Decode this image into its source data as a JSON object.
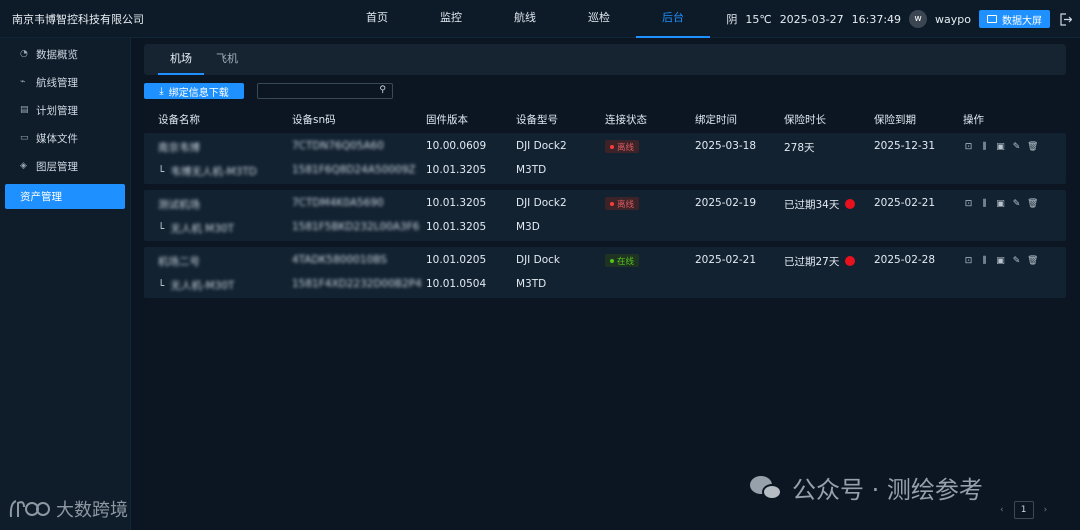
{
  "header": {
    "company": "南京韦博智控科技有限公司",
    "nav": [
      {
        "label": "首页",
        "active": false
      },
      {
        "label": "监控",
        "active": false
      },
      {
        "label": "航线",
        "active": false
      },
      {
        "label": "巡检",
        "active": false
      },
      {
        "label": "后台",
        "active": true
      }
    ],
    "weather": "阴",
    "temperature": "15℃",
    "date": "2025-03-27",
    "time": "16:37:49",
    "avatar_letter": "w",
    "username": "waypo",
    "dashboard_button": "数据大屏"
  },
  "sidebar": {
    "items": [
      {
        "label": "数据概览",
        "icon": "pie-icon",
        "active": false
      },
      {
        "label": "航线管理",
        "icon": "route-icon",
        "active": false
      },
      {
        "label": "计划管理",
        "icon": "calendar-icon",
        "active": false
      },
      {
        "label": "媒体文件",
        "icon": "folder-icon",
        "active": false
      },
      {
        "label": "图层管理",
        "icon": "layers-icon",
        "active": false
      },
      {
        "label": "资产管理",
        "icon": "",
        "active": true
      }
    ]
  },
  "tabs": [
    {
      "label": "机场",
      "active": true
    },
    {
      "label": "飞机",
      "active": false
    }
  ],
  "toolbar": {
    "download_label": "绑定信息下载",
    "search_placeholder": ""
  },
  "table": {
    "columns": [
      "设备名称",
      "设备sn码",
      "固件版本",
      "设备型号",
      "连接状态",
      "绑定时间",
      "保险时长",
      "保险到期",
      "操作"
    ],
    "groups": [
      {
        "dock": {
          "name": "南京韦博",
          "sn": "7CTDN76Q05A60",
          "firmware": "10.00.0609",
          "model": "DJI Dock2",
          "status": "离线",
          "status_type": "offline",
          "bind_time": "2025-03-18",
          "insurance": "278天",
          "insurance_warn": false,
          "expire": "2025-12-31"
        },
        "drone": {
          "name": "韦博无人机-M3TD",
          "sn": "1581F6Q8D24A50009Z",
          "firmware": "10.01.3205",
          "model": "M3TD"
        }
      },
      {
        "dock": {
          "name": "测试机场",
          "sn": "7CTDM4K0A5690",
          "firmware": "10.01.3205",
          "model": "DJI Dock2",
          "status": "离线",
          "status_type": "offline",
          "bind_time": "2025-02-19",
          "insurance": "已过期34天",
          "insurance_warn": true,
          "expire": "2025-02-21"
        },
        "drone": {
          "name": "无人机 M30T",
          "sn": "1581F5BKD232L00A3F6",
          "firmware": "10.01.3205",
          "model": "M3D"
        }
      },
      {
        "dock": {
          "name": "机场二号",
          "sn": "4TADK5800010BS",
          "firmware": "10.01.0205",
          "model": "DJI Dock",
          "status": "在线",
          "status_type": "online",
          "bind_time": "2025-02-21",
          "insurance": "已过期27天",
          "insurance_warn": true,
          "expire": "2025-02-28"
        },
        "drone": {
          "name": "无人机-M30T",
          "sn": "1581F4XD2232D00B2P4",
          "firmware": "10.01.0504",
          "model": "M3TD"
        }
      }
    ],
    "ops": [
      "detail-icon",
      "config-icon",
      "camera-icon",
      "edit-icon",
      "delete-icon"
    ]
  },
  "pagination": {
    "current": "1"
  },
  "watermark": {
    "left": "大数跨境",
    "right": "公众号 · 测绘参考"
  },
  "colors": {
    "accent": "#1e90ff",
    "offline": "#ff3b3b",
    "online": "#52c41a",
    "warn": "#e8111d"
  }
}
